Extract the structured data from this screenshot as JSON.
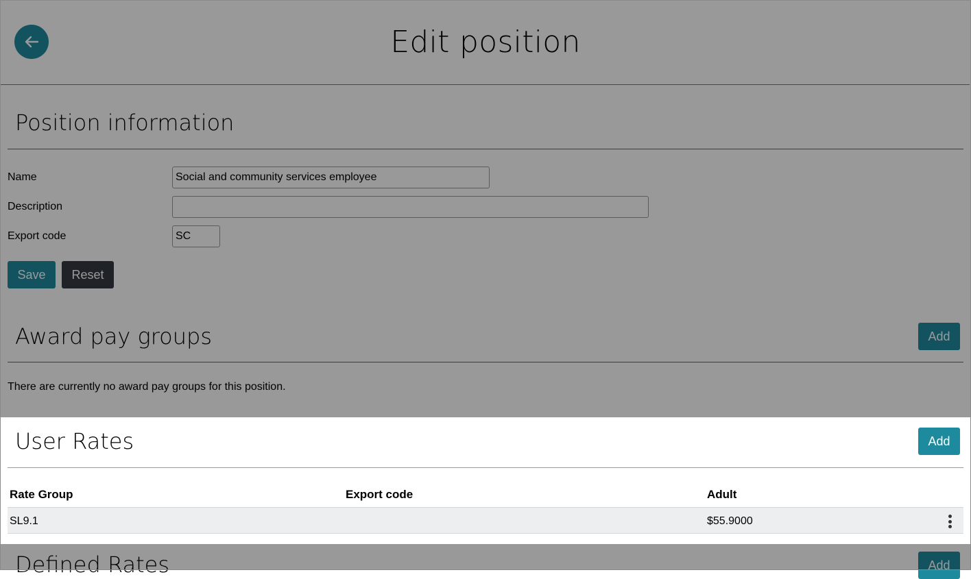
{
  "header": {
    "title": "Edit position",
    "back_icon": "arrow-left-icon"
  },
  "position_info": {
    "title": "Position information",
    "fields": {
      "name": {
        "label": "Name",
        "value": "Social and community services employee"
      },
      "description": {
        "label": "Description",
        "value": ""
      },
      "export_code": {
        "label": "Export code",
        "value": "SC"
      }
    },
    "save_label": "Save",
    "reset_label": "Reset"
  },
  "award_pay_groups": {
    "title": "Award pay groups",
    "add_label": "Add",
    "empty_message": "There are currently no award pay groups for this position."
  },
  "user_rates": {
    "title": "User Rates",
    "add_label": "Add",
    "columns": [
      "Rate Group",
      "Export code",
      "Adult"
    ],
    "rows": [
      {
        "rate_group": "SL9.1",
        "export_code": "",
        "adult": "$55.9000"
      }
    ]
  },
  "defined_rates": {
    "title": "Defined Rates",
    "add_label": "Add"
  },
  "colors": {
    "accent": "#1e8a9e",
    "dark_button": "#343a40",
    "overlay": "rgba(0,0,0,0.40)"
  }
}
